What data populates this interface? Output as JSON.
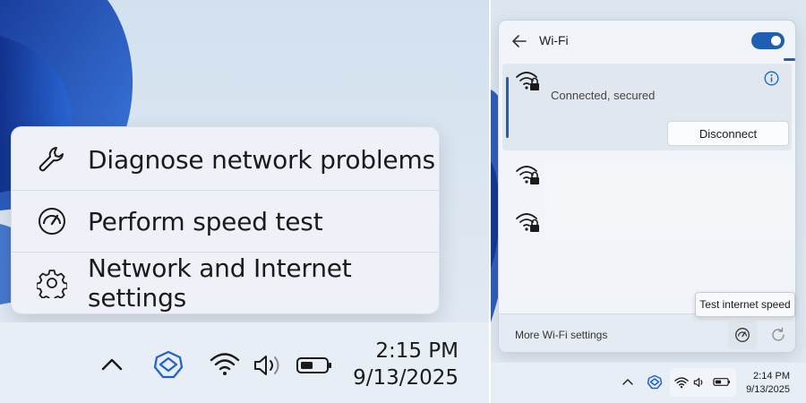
{
  "left_context_menu": {
    "items": [
      {
        "label": "Diagnose network problems",
        "icon": "wrench-icon"
      },
      {
        "label": "Perform speed test",
        "icon": "speedometer-icon"
      },
      {
        "label": "Network and Internet settings",
        "icon": "gear-icon"
      }
    ]
  },
  "left_taskbar": {
    "icons": [
      "chevron-up-icon",
      "app-icon",
      "wifi-icon",
      "volume-icon",
      "battery-icon"
    ],
    "time": "2:15 PM",
    "date": "9/13/2025"
  },
  "wifi_flyout": {
    "title": "Wi-Fi",
    "toggle_on": true,
    "connected_network": {
      "status": "Connected, secured",
      "disconnect_label": "Disconnect"
    },
    "other_networks": [
      {
        "icon": "wifi-secured-icon"
      },
      {
        "icon": "wifi-secured-icon"
      }
    ],
    "footer": {
      "more_settings": "More Wi-Fi settings"
    },
    "tooltip": "Test internet speed"
  },
  "right_taskbar": {
    "time": "2:14 PM",
    "date": "9/13/2025"
  },
  "colors": {
    "accent": "#1e5fb4",
    "wallpaper_blue": "#1d4fb8"
  }
}
